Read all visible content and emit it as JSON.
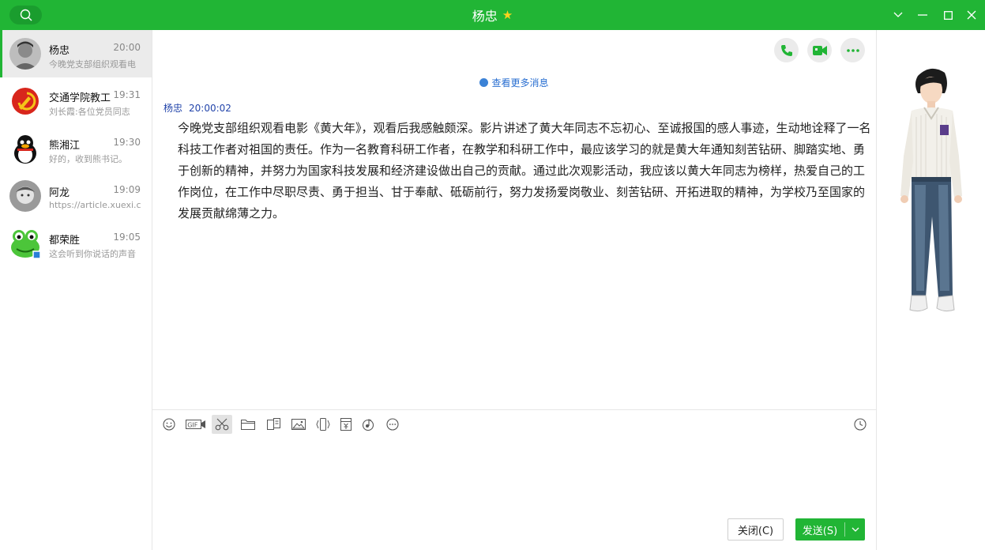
{
  "window": {
    "title": "杨忠",
    "colors": {
      "accent": "#21b535",
      "link": "#2a6fd1"
    }
  },
  "chats": [
    {
      "name": "杨忠",
      "time": "20:00",
      "preview": "今晚党支部组织观看电",
      "active": true
    },
    {
      "name": "交通学院教工",
      "time": "19:31",
      "preview": "刘长霞:各位党员同志"
    },
    {
      "name": "熊湘江",
      "time": "19:30",
      "preview": "好的，收到熊书记。"
    },
    {
      "name": "阿龙",
      "time": "19:09",
      "preview": "https://article.xuexi.cn"
    },
    {
      "name": "都荣胜",
      "time": "19:05",
      "preview": "这会听到你说话的声音"
    }
  ],
  "conversation": {
    "more_messages": "查看更多消息",
    "message": {
      "sender": "杨忠",
      "time": "20:00:02",
      "text": "今晚党支部组织观看电影《黄大年》，观看后我感触颇深。影片讲述了黄大年同志不忘初心、至诚报国的感人事迹，生动地诠释了一名科技工作者对祖国的责任。作为一名教育科研工作者，在教学和科研工作中，最应该学习的就是黄大年通知刻苦钻研、脚踏实地、勇于创新的精神，并努力为国家科技发展和经济建设做出自己的贡献。通过此次观影活动，我应该以黄大年同志为榜样，热爱自己的工作岗位，在工作中尽职尽责、勇于担当、甘于奉献、砥砺前行，努力发扬爱岗敬业、刻苦钻研、开拓进取的精神，为学校乃至国家的发展贡献绵薄之力。"
    }
  },
  "toolbar_icons": [
    "emoji-icon",
    "gif-icon",
    "scissors-icon",
    "folder-icon",
    "doc-icon",
    "image-icon",
    "shake-icon",
    "red-packet-icon",
    "music-icon",
    "more-icon",
    "history-clock-icon"
  ],
  "composer": {
    "close_label": "关闭(C)",
    "send_label": "发送(S)"
  }
}
